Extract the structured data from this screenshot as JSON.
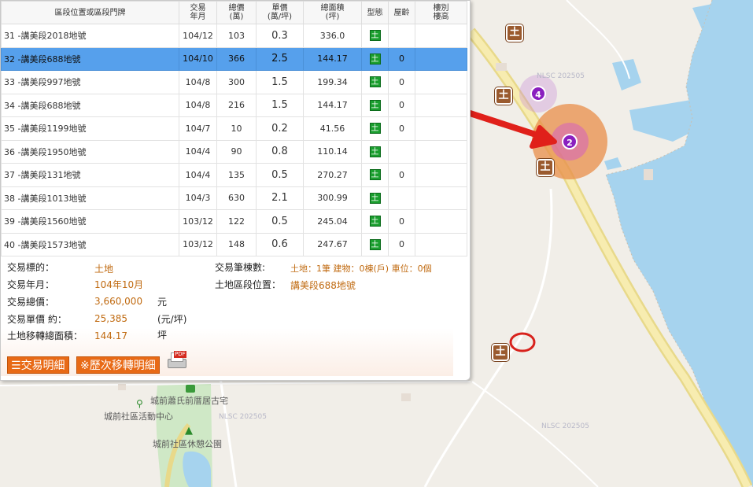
{
  "table": {
    "headers": {
      "location": "區段位置或區段門牌",
      "date": "交易\n年月",
      "total": "總價\n(萬)",
      "unit": "單價\n(萬/坪)",
      "area": "總面積\n(坪)",
      "type": "型態",
      "age": "屋齡",
      "floor": "樓別\n樓高"
    },
    "rows": [
      {
        "location": "31 -講美段2018地號",
        "date": "104/12",
        "total": "103",
        "unit": "0.3",
        "area": "336.0",
        "type": "土",
        "age": ""
      },
      {
        "location": "32 -講美段688地號",
        "date": "104/10",
        "total": "366",
        "unit": "2.5",
        "area": "144.17",
        "type": "土",
        "age": "0"
      },
      {
        "location": "33 -講美段997地號",
        "date": "104/8",
        "total": "300",
        "unit": "1.5",
        "area": "199.34",
        "type": "土",
        "age": "0"
      },
      {
        "location": "34 -講美段688地號",
        "date": "104/8",
        "total": "216",
        "unit": "1.5",
        "area": "144.17",
        "type": "土",
        "age": "0"
      },
      {
        "location": "35 -講美段1199地號",
        "date": "104/7",
        "total": "10",
        "unit": "0.2",
        "area": "41.56",
        "type": "土",
        "age": "0"
      },
      {
        "location": "36 -講美段1950地號",
        "date": "104/4",
        "total": "90",
        "unit": "0.8",
        "area": "110.14",
        "type": "土",
        "age": ""
      },
      {
        "location": "37 -講美段131地號",
        "date": "104/4",
        "total": "135",
        "unit": "0.5",
        "area": "270.27",
        "type": "土",
        "age": "0"
      },
      {
        "location": "38 -講美段1013地號",
        "date": "104/3",
        "total": "630",
        "unit": "2.1",
        "area": "300.99",
        "type": "土",
        "age": ""
      },
      {
        "location": "39 -講美段1560地號",
        "date": "103/12",
        "total": "122",
        "unit": "0.5",
        "area": "245.04",
        "type": "土",
        "age": "0"
      },
      {
        "location": "40 -講美段1573地號",
        "date": "103/12",
        "total": "148",
        "unit": "0.6",
        "area": "247.67",
        "type": "土",
        "age": "0"
      }
    ]
  },
  "detail": {
    "subject_label": "交易標的：",
    "subject_value": "土地",
    "date_label": "交易年月：",
    "date_value": "104年10月",
    "total_label": "交易總價：",
    "total_value": "3,660,000",
    "total_unit": "元",
    "unit_label": "交易單價 約：",
    "unit_value": "25,385",
    "unit_unit": "(元/坪)",
    "area_label": "土地移轉總面積：",
    "area_value": "144.17",
    "area_unit": "坪",
    "count_label": "交易筆棟數:",
    "count_value": "土地：1筆 建物：0棟(戶) 車位：0個",
    "loc_label": "土地區段位置：",
    "loc_value": "講美段688地號"
  },
  "buttons": {
    "detail": "交易明細",
    "history": "※歷次移轉明細",
    "pdf_icon_text": "PDF"
  },
  "map": {
    "pois": {
      "house": "城前蕭氏前厝居古宅",
      "center": "城前社區活動中心",
      "park": "城前社區休憩公園"
    },
    "watermark": "NLSC 202505",
    "cluster_4": "4",
    "cluster_2": "2",
    "land_marker": "土"
  },
  "colors": {
    "selected_row": "#56a0ec",
    "land_badge": "#1a9e2e",
    "marker": "#9a5a2e",
    "button": "#e86a16",
    "sea": "#a6d3ee",
    "arrow": "#e0201a"
  }
}
